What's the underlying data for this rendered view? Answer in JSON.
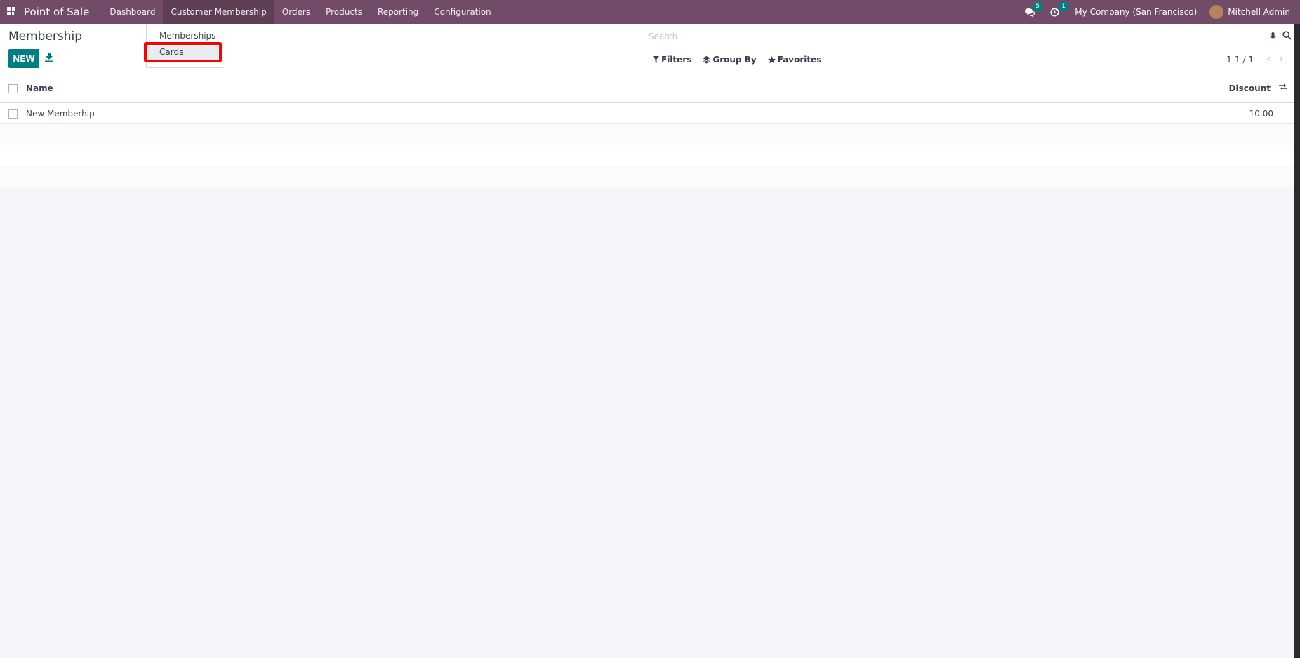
{
  "navbar": {
    "brand": "Point of Sale",
    "menu": [
      "Dashboard",
      "Customer Membership",
      "Orders",
      "Products",
      "Reporting",
      "Configuration"
    ],
    "active_menu": "Customer Membership",
    "messages_badge": "5",
    "activities_badge": "1",
    "company": "My Company (San Francisco)",
    "user": "Mitchell Admin"
  },
  "dropdown": {
    "items": [
      "Memberships",
      "Cards"
    ],
    "highlighted": "Cards"
  },
  "control": {
    "title": "Membership",
    "new_label": "NEW",
    "search_placeholder": "Search...",
    "filters_label": "Filters",
    "groupby_label": "Group By",
    "favorites_label": "Favorites",
    "pager": "1-1 / 1"
  },
  "table": {
    "columns": [
      "Name",
      "Discount"
    ],
    "rows": [
      {
        "name": "New Memberhip",
        "discount": "10.00"
      }
    ]
  },
  "colors": {
    "navbar": "#714b67",
    "primary_button": "#017e84",
    "highlight": "#ff0000"
  }
}
